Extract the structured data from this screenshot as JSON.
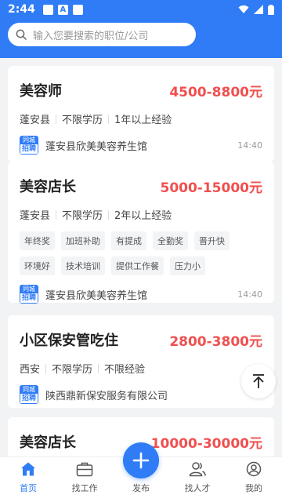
{
  "status_bar": {
    "time": "2:44",
    "icon_a": "A"
  },
  "search": {
    "placeholder": "输入您要搜索的职位/公司"
  },
  "jobs": [
    {
      "title": "美容师",
      "salary": "4500-8800元",
      "location": "蓬安县",
      "education": "不限学历",
      "experience": "1年以上经验",
      "tags": [],
      "logo_top": "同城",
      "logo_bottom": "招聘",
      "company": "蓬安县欣美美容养生馆",
      "time": "14:40"
    },
    {
      "title": "美容店长",
      "salary": "5000-15000元",
      "location": "蓬安县",
      "education": "不限学历",
      "experience": "2年以上经验",
      "tags": [
        "年终奖",
        "加班补助",
        "有提成",
        "全勤奖",
        "晋升快",
        "环境好",
        "技术培训",
        "提供工作餐",
        "压力小"
      ],
      "logo_top": "同城",
      "logo_bottom": "招聘",
      "company": "蓬安县欣美美容养生馆",
      "time": "14:40"
    },
    {
      "title": "小区保安管吃住",
      "salary": "2800-3800元",
      "location": "西安",
      "education": "不限学历",
      "experience": "不限经验",
      "tags": [],
      "logo_top": "同城",
      "logo_bottom": "招聘",
      "company": "陕西鼎新保安服务有限公司",
      "time": ""
    },
    {
      "title": "美容店长",
      "salary": "10000-30000元"
    }
  ],
  "tabbar": {
    "home": "首页",
    "find_job": "找工作",
    "publish": "发布",
    "find_talent": "找人才",
    "mine": "我的"
  },
  "colors": {
    "primary": "#2f7cf6",
    "salary": "#f05050"
  }
}
